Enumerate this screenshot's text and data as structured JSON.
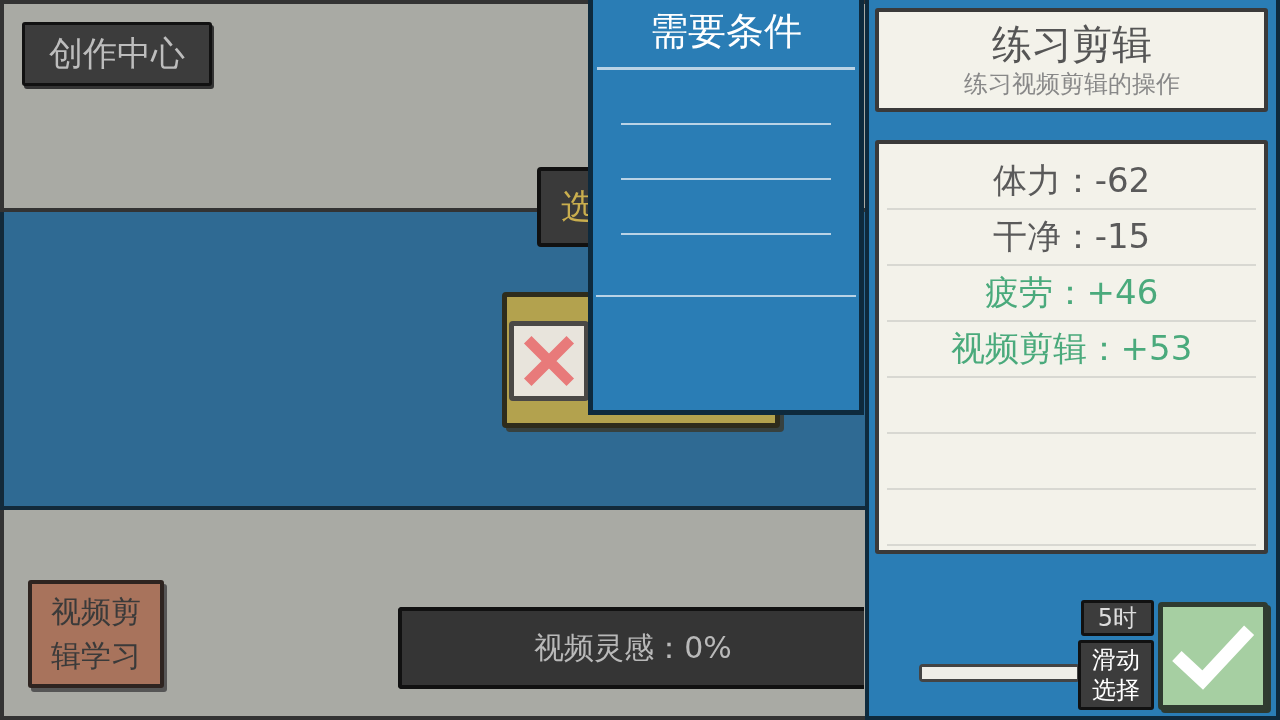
{
  "header_button": {
    "label": "创作中心"
  },
  "hidden_button": {
    "label": "选"
  },
  "requirements_panel": {
    "title": "需要条件"
  },
  "course_button": {
    "label": "视频剪辑学习"
  },
  "inspiration_bar": {
    "label": "视频灵感：0%"
  },
  "activity": {
    "title": "练习剪辑",
    "subtitle": "练习视频剪辑的操作"
  },
  "effects": [
    {
      "text": "体力：-62",
      "color": "#5a5a5a"
    },
    {
      "text": "干净：-15",
      "color": "#5a5a5a"
    },
    {
      "text": "疲劳：+46",
      "color": "#4aaa7c"
    },
    {
      "text": "视频剪辑：+53",
      "color": "#4aaa7c"
    }
  ],
  "duration": {
    "value": "5时",
    "level": 1,
    "handle_label": "滑动选择"
  },
  "confirm_button": {
    "enabled": true
  }
}
